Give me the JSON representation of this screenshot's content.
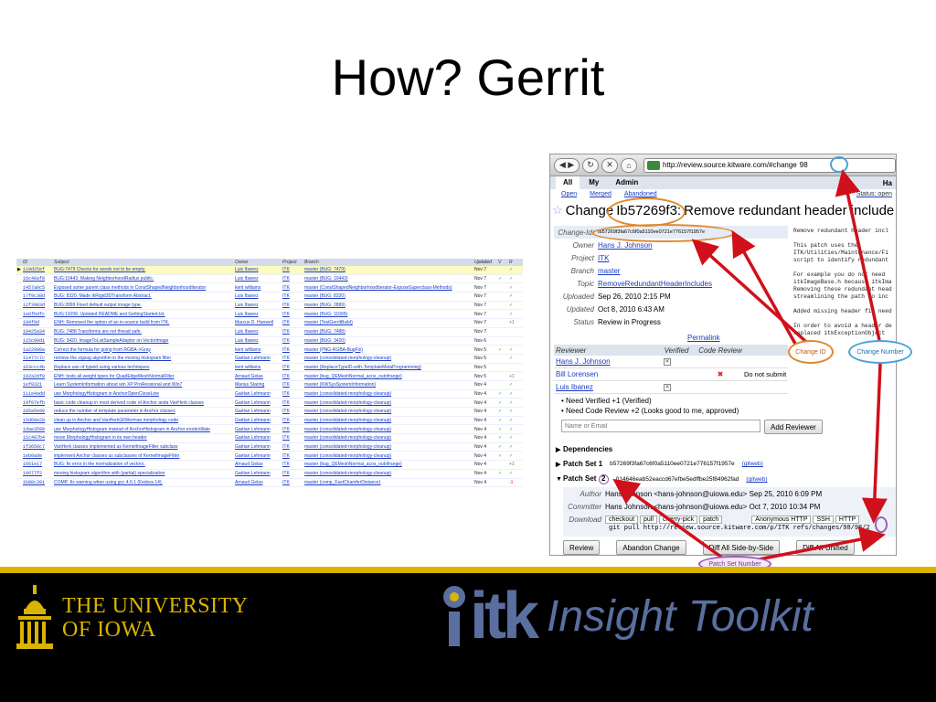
{
  "slide": {
    "title": "How? Gerrit"
  },
  "change_list": {
    "headers": [
      "ID",
      "Subject",
      "Owner",
      "Project",
      "Branch",
      "Updated",
      "V",
      "R"
    ],
    "rows": [
      {
        "id": "119d25ef",
        "subject": "BUG:7479 Checks for seeds not to be empty.",
        "owner": "Luis Ibanez",
        "project": "ITK",
        "branch": "master (BUG: 7479)",
        "updated": "Nov 7",
        "v": "",
        "r": "✓",
        "selected": true
      },
      {
        "id": "16c40af8",
        "subject": "BUG:10443. Making NeighborhoodRadius public.",
        "owner": "Luis Ibanez",
        "project": "ITK",
        "branch": "master (BUG: 10443)",
        "updated": "Nov 7",
        "v": "✓",
        "r": "✓"
      },
      {
        "id": "1457a0c5",
        "subject": "Exposed some parent class methods in ConstShapedNeighborhoodIterator",
        "owner": "kent williams",
        "project": "ITK",
        "branch": "master (ConstShapedNeighborhoodIterator-ExposeSuperclass-Methods)",
        "updated": "Nov 7",
        "v": "",
        "r": "✓"
      },
      {
        "id": "17f9c38d",
        "subject": "BUG: 8320. Made IkRigid3DTransform Abstract.",
        "owner": "Luis Ibanez",
        "project": "ITK",
        "branch": "master (BUG: 8320)",
        "updated": "Nov 7",
        "v": "",
        "r": "✓"
      },
      {
        "id": "12f3983d",
        "subject": "BUG:2899 Fixed default output image type.",
        "owner": "Luis Ibanez",
        "project": "ITK",
        "branch": "master (BUG: 2899)",
        "updated": "Nov 7",
        "v": "",
        "r": "✓"
      },
      {
        "id": "1e8fbdfc",
        "subject": "BUG:11099. Updated README and GettingStarted.txt.",
        "owner": "Luis Ibanez",
        "project": "ITK",
        "branch": "master (BUG: 11099)",
        "updated": "Nov 7",
        "v": "",
        "r": "✓"
      },
      {
        "id": "104f0d",
        "subject": "ENH: Removed the option of an in-source build from ITK.",
        "owner": "Marcus D. Hanwell",
        "project": "ITK",
        "branch": "master (TestGerritBuild)",
        "updated": "Nov 7",
        "v": "",
        "r": "+1"
      },
      {
        "id": "10425a34",
        "subject": "BUG: 7488 Transforms are not thread safe.",
        "owner": "Luis Ibanez",
        "project": "ITK",
        "branch": "master (BUG: 7488)",
        "updated": "Nov 7",
        "v": "",
        "r": ""
      },
      {
        "id": "115c00d1",
        "subject": "BUG: 3420. ImageToListSampleAdaptor on VectorImage",
        "owner": "Luis Ibanez",
        "project": "ITK",
        "branch": "master (BUG: 3420)",
        "updated": "Nov 6",
        "v": "",
        "r": ""
      },
      {
        "id": "1a22900a",
        "subject": "Correct the formula for going from RGBA->Gray",
        "owner": "kent williams",
        "project": "ITK",
        "branch": "master (PNG-RGBA-BugFix)",
        "updated": "Nov 5",
        "v": "✓",
        "r": "✓"
      },
      {
        "id": "11477c7c",
        "subject": "remove the zigzag algorithm in the moving histogram filter",
        "owner": "Gaëtan Lehmann",
        "project": "ITK",
        "branch": "master (consolidated-morphology-cleanup)",
        "updated": "Nov 5",
        "v": "",
        "r": "✓"
      },
      {
        "id": "163ccc4b",
        "subject": "Replace use of typeid using various techniques",
        "owner": "kent williams",
        "project": "ITK",
        "branch": "master (ReplaceTypeID-with-TemplateMetaProgramming)",
        "updated": "Nov 5",
        "v": "",
        "r": ""
      },
      {
        "id": "192a2df0",
        "subject": "ENH: tests all weight types for QuadEdgeMeshNormalFilter",
        "owner": "Arnaud Gelas",
        "project": "ITK",
        "branch": "master (bug_QEMeshNormal_acos_outofrange)",
        "updated": "Nov 5",
        "v": "",
        "r": "+1"
      },
      {
        "id": "1ef8321",
        "subject": "Learn SystemInformation about win XP ProRessional and Win7",
        "owner": "Marius Staring",
        "project": "ITK",
        "branch": "master (KWSysSystemInformation)",
        "updated": "Nov 4",
        "v": "",
        "r": "✓"
      },
      {
        "id": "111e4add",
        "subject": "use MorphologyHistogram in AnchorOpenCloseLine",
        "owner": "Gaëtan Lehmann",
        "project": "ITK",
        "branch": "master (consolidated-morphology-cleanup)",
        "updated": "Nov 4",
        "v": "✓",
        "r": "✓"
      },
      {
        "id": "19f07efb",
        "subject": "basic code cleanup in most derived code of Anchor anda VanHerk classes",
        "owner": "Gaëtan Lehmann",
        "project": "ITK",
        "branch": "master (consolidated-morphology-cleanup)",
        "updated": "Nov 4",
        "v": "✓",
        "r": "✓"
      },
      {
        "id": "185a5e99",
        "subject": "reduce the number of template parameter in Anchor classes",
        "owner": "Gaëtan Lehmann",
        "project": "ITK",
        "branch": "master (consolidated-morphology-cleanup)",
        "updated": "Nov 4",
        "v": "✓",
        "r": "✓"
      },
      {
        "id": "15d60e28",
        "subject": "clean up in Anchor and VanHerkGilWerman morphology code",
        "owner": "Gaëtan Lehmann",
        "project": "ITK",
        "branch": "master (consolidated-morphology-cleanup)",
        "updated": "Nov 4",
        "v": "✓",
        "r": "✓"
      },
      {
        "id": "1dae3590",
        "subject": "use MorphologyHistogram instead of AnchorHistogram in Anchor erode/dilate",
        "owner": "Gaëtan Lehmann",
        "project": "ITK",
        "branch": "master (consolidated-morphology-cleanup)",
        "updated": "Nov 4",
        "v": "✓",
        "r": "✓"
      },
      {
        "id": "11c487b4",
        "subject": "move MorphologyHistogram in its own header",
        "owner": "Gaëtan Lehmann",
        "project": "ITK",
        "branch": "master (consolidated-morphology-cleanup)",
        "updated": "Nov 4",
        "v": "✓",
        "r": "✓"
      },
      {
        "id": "1f3658c7",
        "subject": "VanHerk classes implemented as KernelImageFilter subclass",
        "owner": "Gaëtan Lehmann",
        "project": "ITK",
        "branch": "master (consolidated-morphology-cleanup)",
        "updated": "Nov 4",
        "v": "✓",
        "r": "✓"
      },
      {
        "id": "1eb0ade",
        "subject": "implement Anchor classes us subclasses of KernelImageFilter",
        "owner": "Gaëtan Lehmann",
        "project": "ITK",
        "branch": "master (consolidated-morphology-cleanup)",
        "updated": "Nov 4",
        "v": "✓",
        "r": "✓"
      },
      {
        "id": "1661e17",
        "subject": "BUG: fix error in the normalization of vectors.",
        "owner": "Arnaud Gelas",
        "project": "ITK",
        "branch": "master (bug_QEMeshNormal_acos_outofrange)",
        "updated": "Nov 4",
        "v": "",
        "r": "+1"
      },
      {
        "id": "19677f2",
        "subject": "moving histogram algorithm with (partial) specialization",
        "owner": "Gaëtan Lehmann",
        "project": "ITK",
        "branch": "master (consolidated-morphology-cleanup)",
        "updated": "Nov 4",
        "v": "✓",
        "r": "✓"
      },
      {
        "id": "1b88c391",
        "subject": "COMP: fix warning when using gcc 4.5.1 (Fedora 14).",
        "owner": "Arnaud Gelas",
        "project": "ITK",
        "branch": "master (comp_FastChamferDistance)",
        "updated": "Nov 4",
        "v": "",
        "r": "-1"
      }
    ]
  },
  "browser": {
    "url": "http://review.source.kitware.com/#change",
    "url_change_number": "98",
    "menu": {
      "all": "All",
      "my": "My",
      "admin": "Admin",
      "user": "Ha"
    },
    "subnav": {
      "open": "Open",
      "merged": "Merged",
      "abandoned": "Abandoned",
      "status": "Status: open"
    },
    "change_title_prefix": "Change",
    "change_id_short": "Ib57269f3:",
    "change_subject": "Remove redundant header include",
    "info": {
      "change_id_label": "Change-Id:",
      "change_id_value": "Ib57269f3fa67c6f0a5110ee0721e776157f1957e",
      "owner_label": "Owner",
      "owner_value": "Hans J. Johnson",
      "project_label": "Project",
      "project_value": "ITK",
      "branch_label": "Branch",
      "branch_value": "master",
      "topic_label": "Topic",
      "topic_value": "RemoveRedundantHeaderIncludes",
      "uploaded_label": "Uploaded",
      "uploaded_value": "Sep 26, 2010 2:15 PM",
      "updated_label": "Updated",
      "updated_value": "Oct 8, 2010 6:43 AM",
      "status_label": "Status",
      "status_value": "Review in Progress"
    },
    "permalink": "Permalink",
    "description": "Remove redundant header incl\n\nThis patch uses the\nITK/Utilities/Maintenance/Fi\nscript to identify redundant\n\nFor example you do not need\nitkImageBase.h because itkIma\nRemoving these redundant head\nstreamlining the path to inc\n\nAdded missing header fil need\n\nIn order to avoid a header de\nreplaced itkExceptionObject",
    "reviewers": {
      "h_reviewer": "Reviewer",
      "h_verified": "Verified",
      "h_code_review": "Code Review",
      "rows": [
        {
          "name": "Hans J. Johnson",
          "verified": "",
          "code_review": "",
          "note": ""
        },
        {
          "name": "Bill Lorensen",
          "verified": "",
          "code_review": "✖",
          "note": "Do not submit"
        },
        {
          "name": "Luis Ibanez",
          "verified": "",
          "code_review": "",
          "note": ""
        }
      ]
    },
    "requirements": [
      "Need Verified +1 (Verified)",
      "Need Code Review +2 (Looks good to me, approved)"
    ],
    "add_reviewer_placeholder": "Name or Email",
    "add_reviewer_button": "Add Reviewer",
    "dependencies": "Dependencies",
    "patchset1": {
      "label": "Patch Set",
      "number": "1",
      "rev": "b57269f3fa67c6f0a5110ee0721e776157f1957e",
      "gitweb": "(gitweb)"
    },
    "patchset2": {
      "label": "Patch Set",
      "number": "2",
      "rev": "014646eab52eaccd67efbe5edffbe25f84962fad",
      "gitweb": "(gitweb)"
    },
    "ps_info": {
      "author_label": "Author",
      "author_value": "Hans Johnson <hans-johnson@uiowa.edu> Sep 25, 2010 6:09 PM",
      "committer_label": "Committer",
      "committer_value": "Hans Johnson <hans-johnson@uiowa.edu> Oct 7, 2010 10:34 PM",
      "download_label": "Download",
      "tabs": [
        "checkout",
        "pull",
        "cherry-pick",
        "patch"
      ],
      "proto_tabs": [
        "Anonymous HTTP",
        "SSH",
        "HTTP"
      ],
      "command": "git pull http://review.source.kitware.com/p/ITK refs/changes/98/98/2"
    },
    "actions": [
      "Review",
      "Abandon Change",
      "Diff All Side-by-Side",
      "Diff All Unified"
    ]
  },
  "annotations": {
    "change_id": "Change ID",
    "change_number": "Change Number",
    "patch_set_number": "Patch Set Number"
  },
  "footer": {
    "university_line1": "THE UNIVERSITY",
    "university_line2": "OF IOWA",
    "itk_logo": "itk",
    "itk_tagline": "Insight Toolkit"
  },
  "colors": {
    "annotation_orange": "#e08a2c",
    "annotation_blue": "#4ba3d9",
    "annotation_purple": "#9b5fb5",
    "arrow_red": "#d0101a",
    "gold": "#d9b400"
  }
}
